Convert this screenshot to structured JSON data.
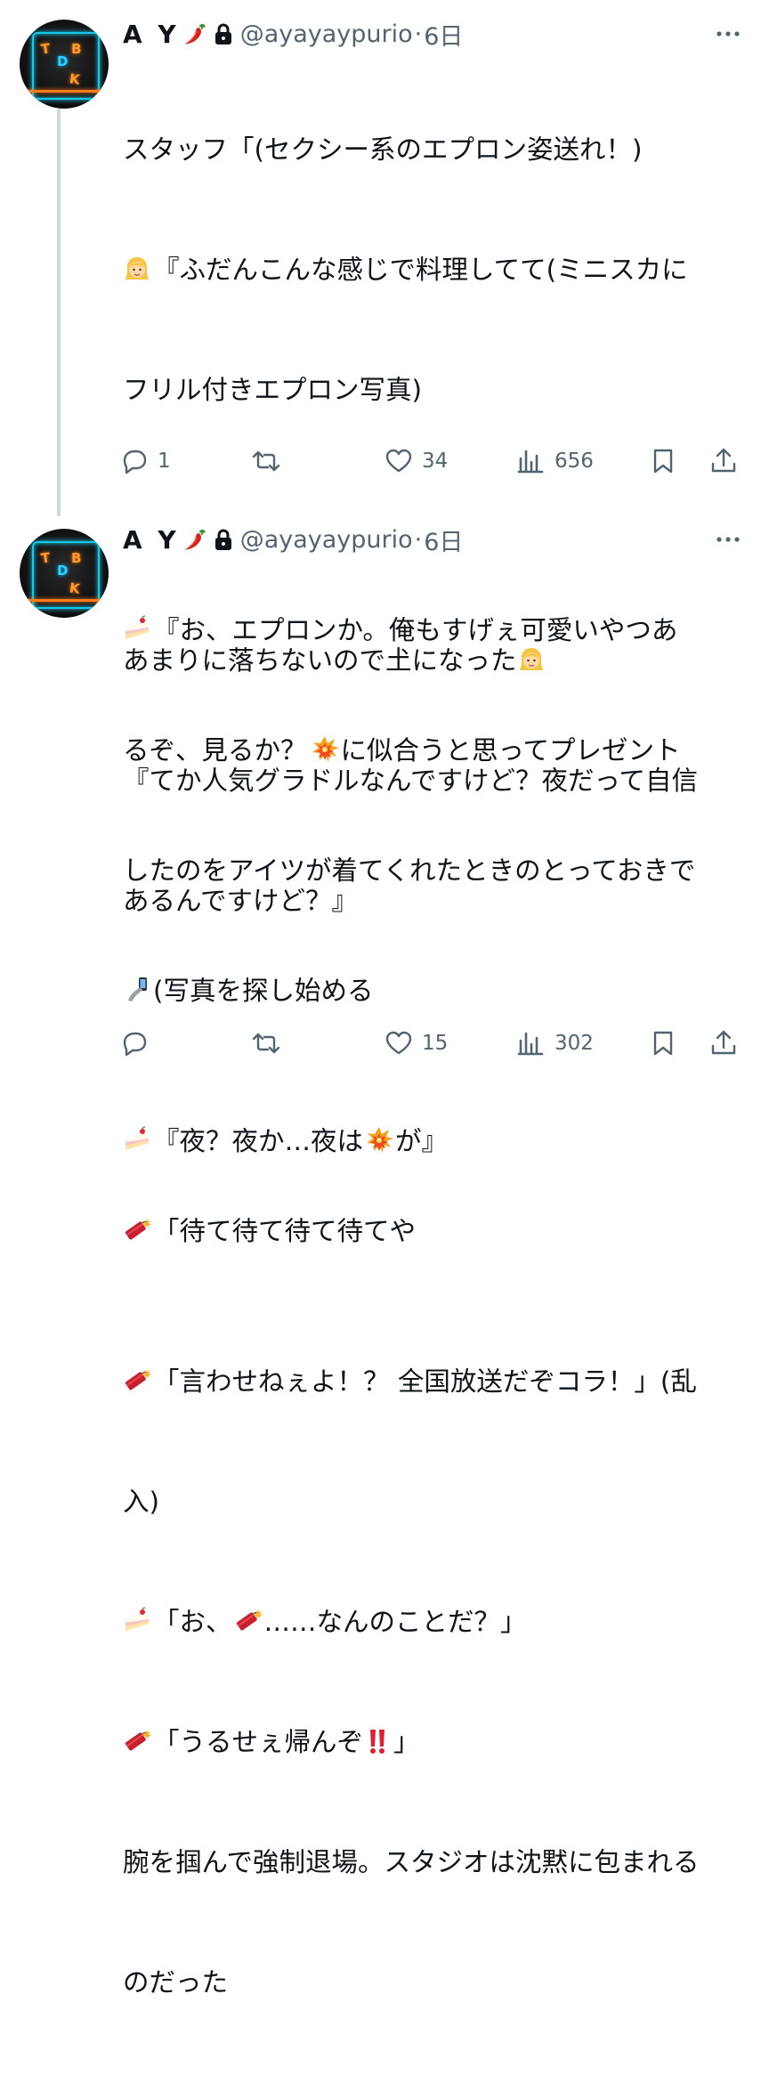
{
  "colors": {
    "text": "#0f1419",
    "secondary": "#536471",
    "thread_line": "#cfd9de"
  },
  "tweets": [
    {
      "author": {
        "name": "A Y",
        "handle": "@ayayaypurio",
        "time": "6日",
        "avatar_letters": [
          "T",
          "D",
          "B",
          "K"
        ]
      },
      "lines": [
        {
          "emoji": "",
          "text": "スタッフ「(セクシー系のエプロン姿送れ！)"
        },
        {
          "emoji": "woman-blonde-emoji",
          "text": "『ふだんこんな感じで料理してて(ミニスカに"
        },
        {
          "emoji": "",
          "text": "フリル付きエプロン写真)"
        },
        {
          "emoji": "",
          "text": ""
        },
        {
          "emoji": "cake-emoji",
          "text": "『お、エプロンか。俺もすげぇ可愛いやつあ"
        },
        {
          "emoji": "",
          "text": "るぞ、見るか？"
        },
        {
          "emoji": "collision-emoji",
          "text": "に似合うと思ってプレゼント"
        },
        {
          "emoji": "",
          "text": "したのをアイツが着てくれたときのとっておきで"
        },
        {
          "emoji": "selfie-emoji",
          "text": "(写真を探し始める"
        },
        {
          "emoji": "",
          "text": ""
        },
        {
          "emoji": "firecracker-emoji",
          "text": "「待て待て待て待てや"
        }
      ],
      "stats": {
        "replies": "1",
        "retweets": "",
        "likes": "34",
        "views": "656"
      }
    },
    {
      "author": {
        "name": "A Y",
        "handle": "@ayayaypurio",
        "time": "6日",
        "avatar_letters": [
          "T",
          "D",
          "B",
          "K"
        ]
      },
      "lines": [
        {
          "emoji": "",
          "text": "あまりに落ちないので𡈽になった"
        },
        {
          "emoji": "",
          "text": "『てか人気グラドルなんですけど？夜だって自信"
        },
        {
          "emoji": "",
          "text": "あるんですけど？』"
        },
        {
          "emoji": "",
          "text": ""
        },
        {
          "emoji": "cake-emoji",
          "text": "『夜？夜か…夜は"
        },
        {
          "emoji": "",
          "text": ""
        },
        {
          "emoji": "firecracker-emoji",
          "text": "「言わせねぇよ！？ 全国放送だぞコラ！」(乱"
        },
        {
          "emoji": "",
          "text": "入)"
        },
        {
          "emoji": "cake-emoji",
          "text": "「お、"
        },
        {
          "emoji": "firecracker-emoji",
          "text": "「うるせぇ帰んぞ"
        },
        {
          "emoji": "",
          "text": "腕を掴んで強制退場。スタジオは沈黙に包まれる"
        },
        {
          "emoji": "",
          "text": "のだった"
        }
      ],
      "inline": {
        "l0_tail_emoji": "woman-blonde-emoji",
        "l4_tail_emoji": "collision-emoji",
        "l4_tail_text": "が』",
        "l8_mid_emoji": "firecracker-emoji",
        "l8_tail_text": "……なんのことだ？」",
        "l9_tail_emoji": "double-exclamation-emoji",
        "l9_tail_text": "」"
      },
      "stats": {
        "replies": "",
        "retweets": "",
        "likes": "15",
        "views": "302"
      }
    }
  ]
}
